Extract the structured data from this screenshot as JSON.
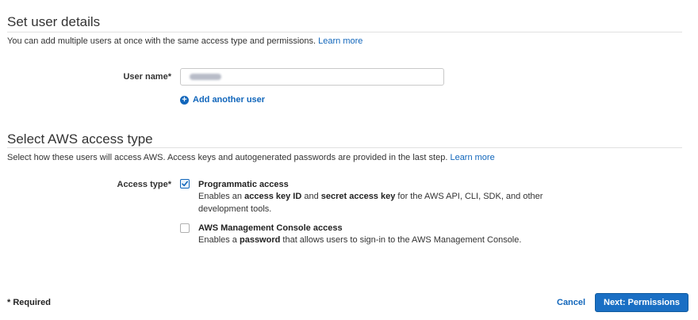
{
  "section1": {
    "title": "Set user details",
    "description": "You can add multiple users at once with the same access type and permissions.",
    "learn_more": "Learn more"
  },
  "user_name": {
    "label": "User name*",
    "value": ""
  },
  "add_user": {
    "label": "Add another user",
    "icon": "plus-circle-icon"
  },
  "section2": {
    "title": "Select AWS access type",
    "description": "Select how these users will access AWS. Access keys and autogenerated passwords are provided in the last step.",
    "learn_more": "Learn more"
  },
  "access_type": {
    "label": "Access type*",
    "options": [
      {
        "title": "Programmatic access",
        "checked": true,
        "desc_parts": [
          "Enables an ",
          "access key ID",
          " and ",
          "secret access key",
          " for the AWS API, CLI, SDK, and other development tools."
        ]
      },
      {
        "title": "AWS Management Console access",
        "checked": false,
        "desc_parts": [
          "Enables a ",
          "password",
          " that allows users to sign-in to the AWS Management Console."
        ]
      }
    ]
  },
  "footer": {
    "required": "* Required",
    "cancel": "Cancel",
    "next": "Next: Permissions"
  },
  "colors": {
    "accent": "#1166bb",
    "button": "#1a6fc4"
  }
}
